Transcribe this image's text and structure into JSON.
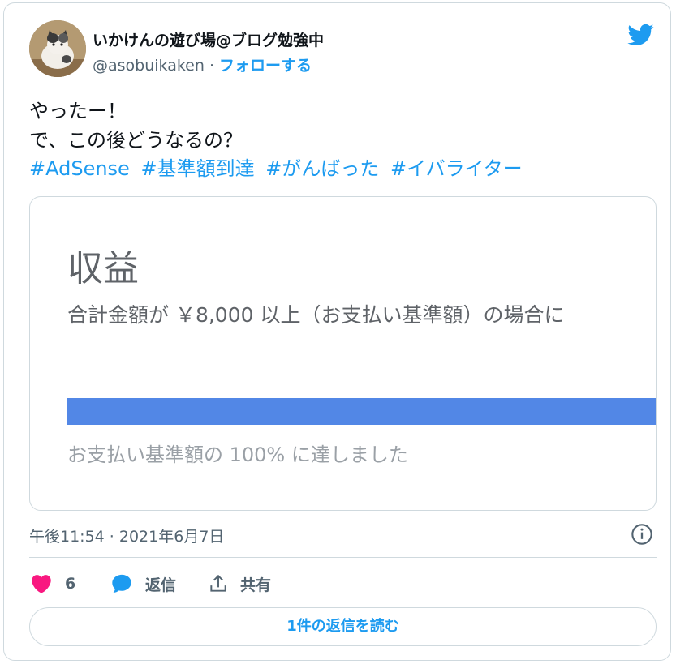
{
  "author": {
    "display_name": "いかけんの遊び場@ブログ勉強中",
    "handle": "@asobuikaken",
    "separator": " · ",
    "follow_label": "フォローする"
  },
  "tweet": {
    "line1": "やったー！",
    "line2": "で、この後どうなるの？",
    "hashtags": [
      "#AdSense",
      "#基準額到達",
      "#がんばった",
      "#イバライター"
    ]
  },
  "media": {
    "title": "収益",
    "subtitle": "合計金額が ￥8,000 以上（お支払い基準額）の場合に",
    "progress_fraction": 1.0,
    "status": "お支払い基準額の 100% に達しました",
    "bar_color": "#5287e6"
  },
  "timestamp": "午後11:54 · 2021年6月7日",
  "actions": {
    "like_count": "6",
    "reply_label": "返信",
    "share_label": "共有"
  },
  "read_replies_label": "1件の返信を読む",
  "colors": {
    "accent": "#1d9bf0",
    "like": "#f91880",
    "text_secondary": "#536471"
  }
}
